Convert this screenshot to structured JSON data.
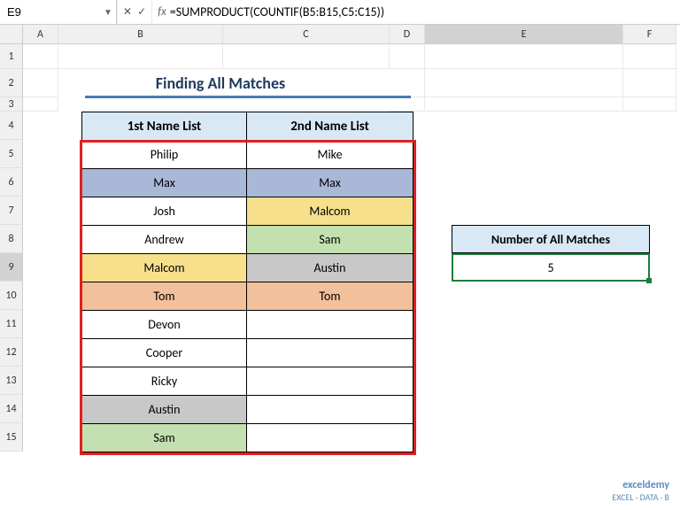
{
  "nameBox": "E9",
  "formula": "=SUMPRODUCT(COUNTIF(B5:B15,C5:C15))",
  "columns": [
    "A",
    "B",
    "C",
    "D",
    "E",
    "F"
  ],
  "rows": [
    "1",
    "2",
    "3",
    "4",
    "5",
    "6",
    "7",
    "8",
    "9",
    "10",
    "11",
    "12",
    "13",
    "14",
    "15"
  ],
  "title": "Finding All Matches",
  "table": {
    "headers": [
      "1st Name List",
      "2nd Name List"
    ],
    "data": [
      {
        "c1": "Philip",
        "c2": "Mike",
        "b1": "",
        "b2": ""
      },
      {
        "c1": "Max",
        "c2": "Max",
        "b1": "bg-blue",
        "b2": "bg-blue"
      },
      {
        "c1": "Josh",
        "c2": "Malcom",
        "b1": "",
        "b2": "bg-yellow"
      },
      {
        "c1": "Andrew",
        "c2": "Sam",
        "b1": "",
        "b2": "bg-green"
      },
      {
        "c1": "Malcom",
        "c2": "Austin",
        "b1": "bg-yellow",
        "b2": "bg-gray"
      },
      {
        "c1": "Tom",
        "c2": "Tom",
        "b1": "bg-orange",
        "b2": "bg-orange"
      },
      {
        "c1": "Devon",
        "c2": "",
        "b1": "",
        "b2": ""
      },
      {
        "c1": "Cooper",
        "c2": "",
        "b1": "",
        "b2": ""
      },
      {
        "c1": "Ricky",
        "c2": "",
        "b1": "",
        "b2": ""
      },
      {
        "c1": "Austin",
        "c2": "",
        "b1": "bg-gray",
        "b2": ""
      },
      {
        "c1": "Sam",
        "c2": "",
        "b1": "bg-green",
        "b2": ""
      }
    ]
  },
  "result": {
    "label": "Number of All Matches",
    "value": "5"
  },
  "watermark": {
    "line1": "exceldemy",
    "line2": "EXCEL · DATA · B"
  }
}
